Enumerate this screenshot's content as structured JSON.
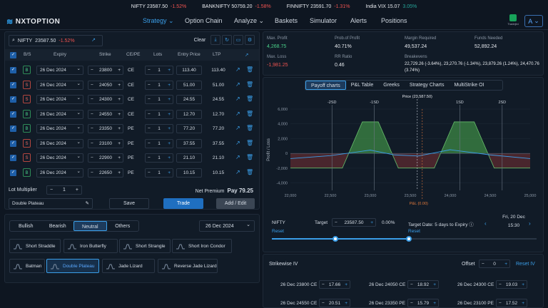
{
  "ticker": [
    {
      "name": "NIFTY",
      "value": "23587.50",
      "change": "-1.52%",
      "dir": "neg"
    },
    {
      "name": "BANKNIFTY",
      "value": "50759.20",
      "change": "-1.58%",
      "dir": "neg"
    },
    {
      "name": "FINNIFTY",
      "value": "23591.70",
      "change": "-1.31%",
      "dir": "neg"
    },
    {
      "name": "India VIX",
      "value": "15.07",
      "change": "3.05%",
      "dir": "pos"
    }
  ],
  "nav": {
    "logo": "NXTOPTION",
    "items": [
      "Strategy",
      "Option Chain",
      "Analyze",
      "Baskets",
      "Simulator",
      "Alerts",
      "Positions"
    ],
    "active": "Strategy",
    "broker": "Tradejini",
    "avatar": "A"
  },
  "symbol": {
    "name": "NIFTY",
    "price": "23587.50",
    "change": "-1.52%",
    "clear": "Clear"
  },
  "table": {
    "headers": {
      "bs": "B/S",
      "expiry": "Expiry",
      "strike": "Strike",
      "cepe": "CE/PE",
      "lots": "Lots",
      "entry": "Entry Price",
      "ltp": "LTP"
    },
    "rows": [
      {
        "bs": "B",
        "expiry": "26 Dec 2024",
        "strike": "23800",
        "type": "CE",
        "lots": "1",
        "entry": "113.40",
        "ltp": "113.40"
      },
      {
        "bs": "S",
        "expiry": "26 Dec 2024",
        "strike": "24050",
        "type": "CE",
        "lots": "1",
        "entry": "51.00",
        "ltp": "51.00"
      },
      {
        "bs": "S",
        "expiry": "26 Dec 2024",
        "strike": "24300",
        "type": "CE",
        "lots": "1",
        "entry": "24.55",
        "ltp": "24.55"
      },
      {
        "bs": "B",
        "expiry": "26 Dec 2024",
        "strike": "24550",
        "type": "CE",
        "lots": "1",
        "entry": "12.70",
        "ltp": "12.70"
      },
      {
        "bs": "B",
        "expiry": "26 Dec 2024",
        "strike": "23350",
        "type": "PE",
        "lots": "1",
        "entry": "77.20",
        "ltp": "77.20"
      },
      {
        "bs": "S",
        "expiry": "26 Dec 2024",
        "strike": "23100",
        "type": "PE",
        "lots": "1",
        "entry": "37.55",
        "ltp": "37.55"
      },
      {
        "bs": "S",
        "expiry": "26 Dec 2024",
        "strike": "22900",
        "type": "PE",
        "lots": "1",
        "entry": "21.10",
        "ltp": "21.10"
      },
      {
        "bs": "B",
        "expiry": "26 Dec 2024",
        "strike": "22650",
        "type": "PE",
        "lots": "1",
        "entry": "10.15",
        "ltp": "10.15"
      }
    ]
  },
  "footer": {
    "lot_label": "Lot Multiplier",
    "lot_value": "1",
    "premium_label": "Net Premium",
    "premium_value": "Pay 79.25",
    "strategy_name": "Double Plateau",
    "save": "Save",
    "trade": "Trade",
    "edit": "Add / Edit"
  },
  "strategies": {
    "tabs": [
      "Bullish",
      "Bearish",
      "Neutral",
      "Others"
    ],
    "active_tab": "Neutral",
    "date": "26 Dec 2024",
    "cards": [
      "Short Straddle",
      "Iron Butterfly",
      "Short Strangle",
      "Short Iron Condor",
      "Batman",
      "Double Plateau",
      "Jade Lizard",
      "Reverse Jade Lizard"
    ],
    "active_card": "Double Plateau"
  },
  "metrics": [
    {
      "label": "Max. Profit",
      "value": "4,268.75",
      "color": "g"
    },
    {
      "label": "Prob.of Profit",
      "value": "40.71%",
      "color": ""
    },
    {
      "label": "Margin Required",
      "value": "49,537.24",
      "color": ""
    },
    {
      "label": "Funds Needed",
      "value": "52,892.24",
      "color": ""
    },
    {
      "label": "Max. Loss",
      "value": "-1,981.25",
      "color": "r"
    },
    {
      "label": "RR Ratio",
      "value": "0.46",
      "color": ""
    },
    {
      "label": "Breakevens",
      "value": "22,729.26 (-3.64%), 23,270.76 (-1.34%), 23,879.26 (1.24%), 24,470.76 (3.74%)",
      "color": ""
    }
  ],
  "chart_tabs": [
    "Payoff charts",
    "P&L Table",
    "Greeks",
    "Strategy Charts",
    "MultiStrike OI"
  ],
  "chart_active": "Payoff charts",
  "chart_data": {
    "type": "area",
    "ylabel": "Profit / Loss",
    "x_ticks": [
      "22,000",
      "22,500",
      "23,000",
      "23,500",
      "24,000",
      "24,500",
      "25,000"
    ],
    "y_ticks": [
      "6,000",
      "4,000",
      "2,000",
      "0",
      "-2,000",
      "-4,000"
    ],
    "xlim": [
      22000,
      25000
    ],
    "ylim": [
      -5000,
      6000
    ],
    "payoff_x": [
      22000,
      22650,
      22900,
      23100,
      23350,
      23800,
      24050,
      24300,
      24550,
      25000
    ],
    "payoff_y": [
      -1981,
      -1981,
      4269,
      4269,
      -1981,
      -1981,
      4269,
      4269,
      -1981,
      -1981
    ],
    "sd_lines": [
      {
        "label": "-2SD",
        "x": 22520
      },
      {
        "label": "-1SD",
        "x": 23050
      },
      {
        "label": "1SD",
        "x": 24120
      },
      {
        "label": "2SD",
        "x": 24650
      }
    ],
    "price_label": "Price (23,587.50)",
    "price_x": 23587.5,
    "target_label": "P&L (0.00)",
    "target_x": 23650,
    "curve_x": [
      22000,
      22500,
      23000,
      23300,
      23600,
      24000,
      24500,
      25000
    ],
    "curve_y": [
      -700,
      -300,
      450,
      -200,
      -350,
      500,
      -200,
      -700
    ]
  },
  "simulator": {
    "symbol": "NIFTY",
    "reset": "Reset",
    "target_label": "Target",
    "target_value": "23587.50",
    "target_pct": "0.00%",
    "date_label": "Target Date: 5 days to Expiry",
    "day": "Fri, 20 Dec",
    "time": "15:30"
  },
  "strikewise": {
    "title": "Strikewise IV",
    "offset_label": "Offset",
    "offset_value": "0",
    "reset": "Reset IV",
    "rows": [
      {
        "label": "26 Dec 23800 CE",
        "value": "17.66"
      },
      {
        "label": "26 Dec 24050 CE",
        "value": "18.92"
      },
      {
        "label": "26 Dec 24300 CE",
        "value": "19.03"
      },
      {
        "label": "26 Dec 24550 CE",
        "value": "20.51"
      },
      {
        "label": "26 Dec 23350 PE",
        "value": "15.79"
      },
      {
        "label": "26 Dec 23100 PE",
        "value": "17.52"
      }
    ]
  }
}
